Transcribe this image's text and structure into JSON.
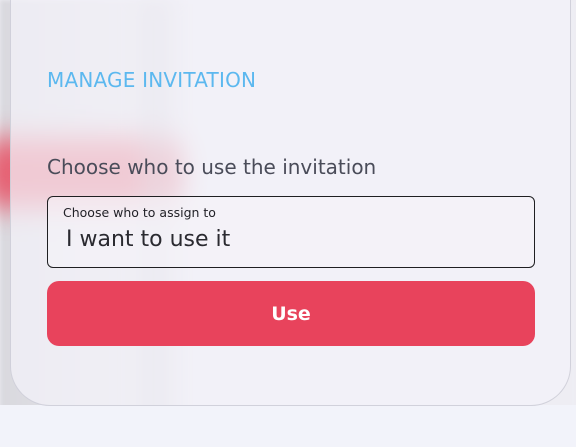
{
  "modal": {
    "title": "MANAGE INVITATION",
    "subtitle": "Choose who to use the invitation",
    "assign_field": {
      "label": "Choose who to assign to",
      "value": "I want to use it"
    },
    "use_button_label": "Use"
  },
  "colors": {
    "title": "#5cb8ef",
    "button": "#e8435c",
    "button_text": "#ffffff"
  }
}
